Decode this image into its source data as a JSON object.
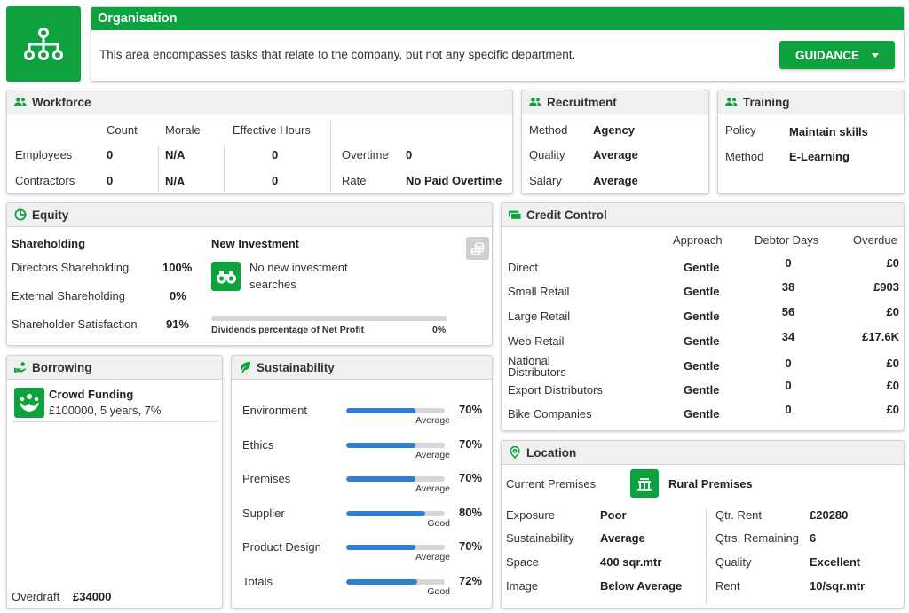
{
  "header": {
    "title": "Organisation",
    "description": "This area encompasses tasks that relate to the company, but not any specific department.",
    "guidance_label": "GUIDANCE",
    "icon": "hierarchy-icon",
    "accent_color": "#0da23e"
  },
  "workforce": {
    "title": "Workforce",
    "col_count": "Count",
    "col_morale": "Morale",
    "col_hours": "Effective Hours",
    "rows": [
      {
        "label": "Employees",
        "count": "0",
        "morale": "N/A",
        "hours": "0"
      },
      {
        "label": "Contractors",
        "count": "0",
        "morale": "N/A",
        "hours": "0"
      }
    ],
    "overtime_label": "Overtime",
    "overtime_value": "0",
    "rate_label": "Rate",
    "rate_value": "No Paid Overtime"
  },
  "recruitment": {
    "title": "Recruitment",
    "rows": [
      {
        "label": "Method",
        "value": "Agency"
      },
      {
        "label": "Quality",
        "value": "Average"
      },
      {
        "label": "Salary",
        "value": "Average"
      }
    ]
  },
  "training": {
    "title": "Training",
    "rows": [
      {
        "label": "Policy",
        "value": "Maintain skills"
      },
      {
        "label": "Method",
        "value": "E-Learning"
      }
    ]
  },
  "equity": {
    "title": "Equity",
    "shareholding_title": "Shareholding",
    "rows": [
      {
        "label": "Directors Shareholding",
        "value": "100%"
      },
      {
        "label": "External Shareholding",
        "value": "0%"
      },
      {
        "label": "Shareholder Satisfaction",
        "value": "91%"
      }
    ],
    "investment_title": "New Investment",
    "investment_text_1": "No new investment",
    "investment_text_2": "searches",
    "dividends_label": "Dividends percentage of Net Profit",
    "dividends_value": "0%",
    "dividends_fraction": 0
  },
  "credit": {
    "title": "Credit Control",
    "col_approach": "Approach",
    "col_days": "Debtor Days",
    "col_overdue": "Overdue",
    "rows": [
      {
        "label": "Direct",
        "approach": "Gentle",
        "days": "0",
        "overdue": "£0"
      },
      {
        "label": "Small Retail",
        "approach": "Gentle",
        "days": "38",
        "overdue": "£903"
      },
      {
        "label": "Large Retail",
        "approach": "Gentle",
        "days": "56",
        "overdue": "£0"
      },
      {
        "label": "Web Retail",
        "approach": "Gentle",
        "days": "34",
        "overdue": "£17.6K"
      },
      {
        "label": "National Distributors",
        "approach": "Gentle",
        "days": "0",
        "overdue": "£0"
      },
      {
        "label": "Export Distributors",
        "approach": "Gentle",
        "days": "0",
        "overdue": "£0"
      },
      {
        "label": "Bike Companies",
        "approach": "Gentle",
        "days": "0",
        "overdue": "£0"
      }
    ]
  },
  "borrowing": {
    "title": "Borrowing",
    "item_title": "Crowd Funding",
    "item_detail": "£100000, 5 years, 7%",
    "overdraft_label": "Overdraft",
    "overdraft_value": "£34000"
  },
  "sustainability": {
    "title": "Sustainability",
    "rows": [
      {
        "label": "Environment",
        "pct": "70%",
        "rating": "Average",
        "fraction": 0.7
      },
      {
        "label": "Ethics",
        "pct": "70%",
        "rating": "Average",
        "fraction": 0.7
      },
      {
        "label": "Premises",
        "pct": "70%",
        "rating": "Average",
        "fraction": 0.7
      },
      {
        "label": "Supplier",
        "pct": "80%",
        "rating": "Good",
        "fraction": 0.8
      },
      {
        "label": "Product Design",
        "pct": "70%",
        "rating": "Average",
        "fraction": 0.7
      },
      {
        "label": "Totals",
        "pct": "72%",
        "rating": "Good",
        "fraction": 0.72
      }
    ]
  },
  "location": {
    "title": "Location",
    "current_label": "Current Premises",
    "current_value": "Rural Premises",
    "left": [
      {
        "label": "Exposure",
        "value": "Poor"
      },
      {
        "label": "Sustainability",
        "value": "Average"
      },
      {
        "label": "Space",
        "value": "400 sqr.mtr"
      },
      {
        "label": "Image",
        "value": "Below Average"
      }
    ],
    "right": [
      {
        "label": "Qtr. Rent",
        "value": "£20280"
      },
      {
        "label": "Qtrs. Remaining",
        "value": "6"
      },
      {
        "label": "Quality",
        "value": "Excellent"
      },
      {
        "label": "Rent",
        "value": "10/sqr.mtr"
      }
    ]
  }
}
